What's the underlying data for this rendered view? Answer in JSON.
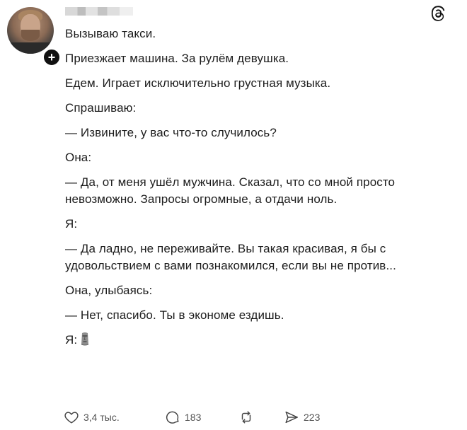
{
  "icons": {
    "threads": "threads-logo-icon",
    "follow": "plus-icon",
    "like": "heart-icon",
    "reply": "comment-icon",
    "repost": "repost-icon",
    "share": "send-icon",
    "emoji": "moai-icon"
  },
  "header": {
    "follow_symbol": "+"
  },
  "post": {
    "lines": [
      "Вызываю такси.",
      "Приезжает машина. За рулём девушка.",
      "Едем. Играет исключительно грустная музыка.",
      "Спрашиваю:",
      "— Извините, у вас что-то случилось?",
      "Она:",
      "— Да, от меня ушёл мужчина. Сказал, что со мной просто невозможно. Запросы огромные, а отдачи ноль.",
      "Я:",
      "— Да ладно, не переживайте. Вы такая красивая, я бы с удовольствием с вами познакомился, если вы не против...",
      "Она, улыбаясь:",
      "— Нет, спасибо. Ты в экономе ездишь.",
      "Я:"
    ]
  },
  "actions": {
    "likes": "3,4 тыс.",
    "replies": "183",
    "shares": "223"
  },
  "colors": {
    "text": "#1c1c1c",
    "muted": "#555555",
    "background": "#ffffff"
  }
}
